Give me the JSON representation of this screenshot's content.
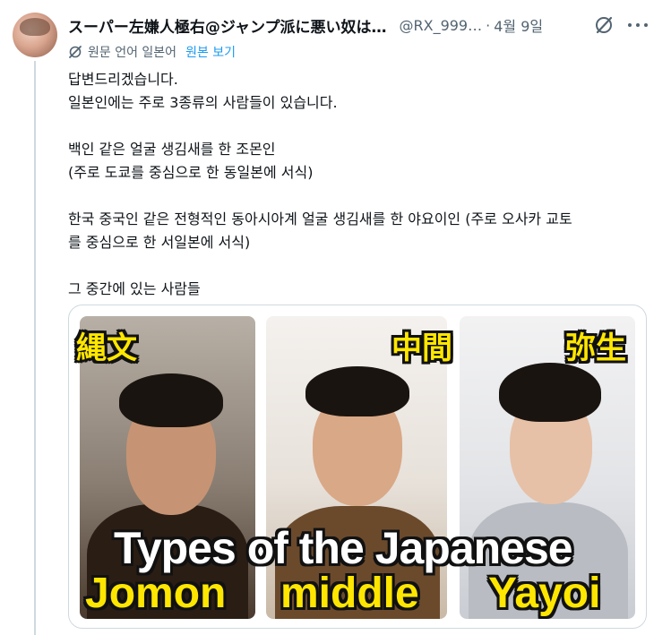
{
  "author": {
    "display_name": "スーパー左嫌人極右@ジャンプ派に悪い奴は…",
    "handle": "@RX_999…",
    "separator": "·",
    "date": "4월 9일"
  },
  "translation": {
    "label": "원문 언어 일본어",
    "show_original": "원본 보기"
  },
  "tweet": {
    "line1": "답변드리겠습니다.",
    "line2": "일본인에는 주로 3종류의 사람들이 있습니다.",
    "line3": "백인 같은 얼굴 생김새를 한 조몬인",
    "line4": "(주로 도쿄를 중심으로 한 동일본에 서식)",
    "line5": "한국 중국인 같은 전형적인 동아시아계 얼굴 생김새를 한 야요이인 (주로 오사카 교토",
    "line6": "를 중심으로 한 서일본에 서식)",
    "line7": "그 중간에 있는 사람들"
  },
  "media": {
    "kanji_jomon": "縄文",
    "kanji_middle": "中間",
    "kanji_yayoi": "弥生",
    "caption": "Types of the Japanese",
    "label_jomon": "Jomon",
    "label_middle": "middle",
    "label_yayoi": "Yayoi"
  },
  "colors": {
    "text": "#0f1419",
    "secondary": "#536471",
    "link": "#1d9bf0",
    "caption_yellow": "#ffe600"
  },
  "icons": {
    "translate": "translate-icon",
    "grok": "grok-icon",
    "more": "more-icon"
  }
}
